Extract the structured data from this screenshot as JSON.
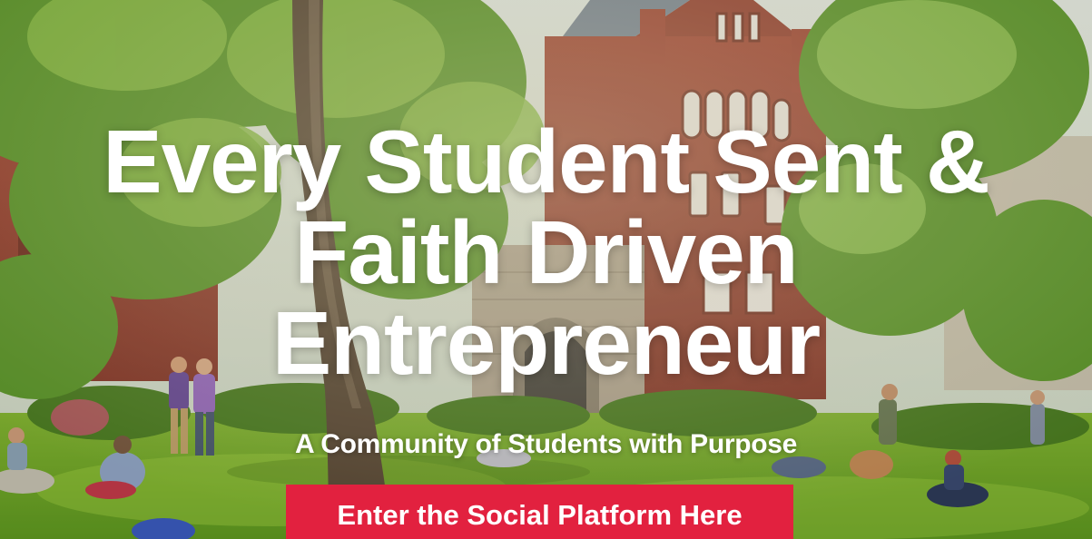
{
  "hero": {
    "headline": [
      "Every Student Sent &",
      "Faith Driven",
      "Entrepreneur"
    ],
    "subtitle": "A Community of Students with Purpose",
    "cta_label": "Enter the Social Platform Here",
    "background": "campus-lawn-photo"
  },
  "colors": {
    "cta_background": "#e2213f",
    "text": "#ffffff"
  }
}
